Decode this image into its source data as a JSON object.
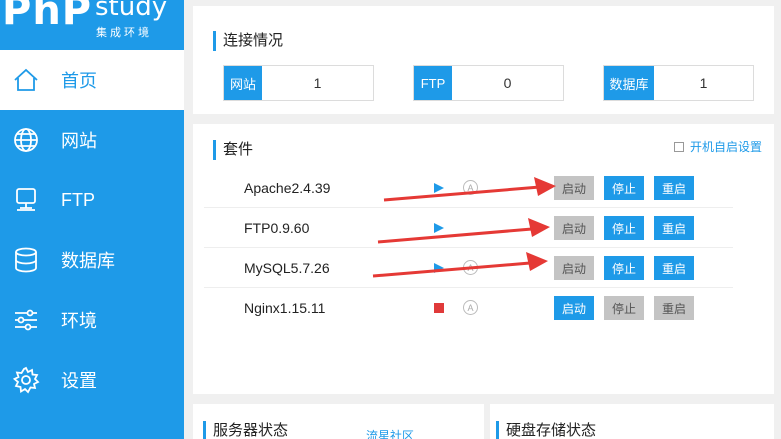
{
  "logo": {
    "name": "PhP",
    "study": "study",
    "subtitle": "集成环境"
  },
  "nav": [
    {
      "label": "首页",
      "icon": "home-icon",
      "active": true
    },
    {
      "label": "网站",
      "icon": "globe-icon"
    },
    {
      "label": "FTP",
      "icon": "server-icon"
    },
    {
      "label": "数据库",
      "icon": "database-icon"
    },
    {
      "label": "环境",
      "icon": "sliders-icon"
    },
    {
      "label": "设置",
      "icon": "gear-icon"
    }
  ],
  "connection": {
    "title": "连接情况",
    "items": [
      {
        "label": "网站",
        "value": "1"
      },
      {
        "label": "FTP",
        "value": "0"
      },
      {
        "label": "数据库",
        "value": "1"
      }
    ]
  },
  "suite": {
    "title": "套件",
    "autostart_label": "开机自启设置",
    "rows": [
      {
        "name": "Apache2.4.39",
        "status": "play-icon"
      },
      {
        "name": "FTP0.9.60",
        "status": "play-icon"
      },
      {
        "name": "MySQL5.7.26",
        "status": "play-icon"
      },
      {
        "name": "Nginx1.15.11",
        "status": "stop-square-icon"
      }
    ],
    "a_symbol": "A",
    "buttons": {
      "start": "启动",
      "stop": "停止",
      "restart": "重启"
    }
  },
  "server_status": {
    "title": "服务器状态",
    "link": "流星社区"
  },
  "disk_status": {
    "title": "硬盘存储状态"
  },
  "colors": {
    "accent": "#1e9ae8",
    "stop": "#e03a3a",
    "arrow": "#e53935",
    "disabled": "#c4c4c4"
  }
}
